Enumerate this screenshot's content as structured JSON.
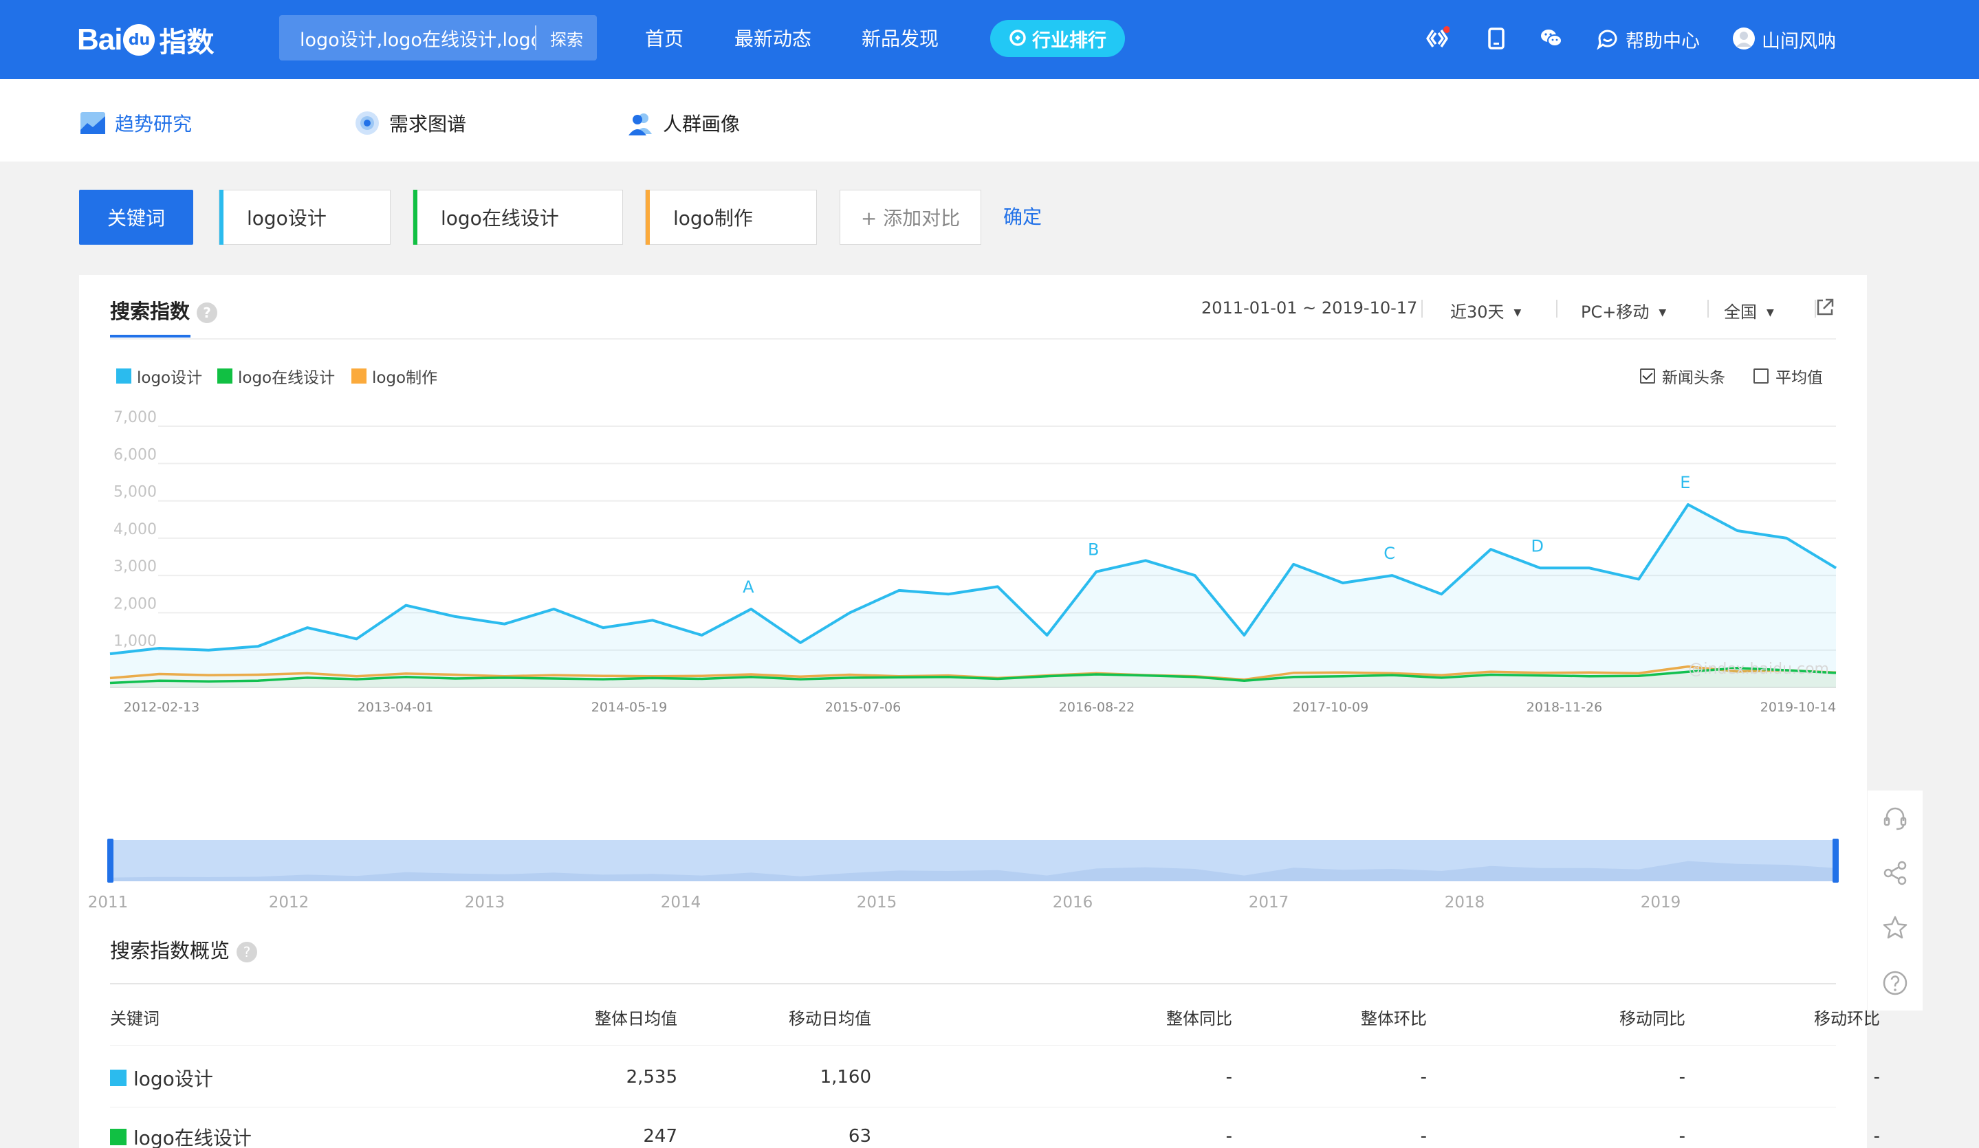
{
  "header": {
    "logo_text_left": "Bai",
    "logo_text_paw": "du",
    "logo_text_right": "指数",
    "search_value": "logo设计,logo在线设计,logo制作",
    "search_button": "探索",
    "nav": [
      "首页",
      "最新动态",
      "新品发现"
    ],
    "rank_label": "行业排行",
    "help_label": "帮助中心",
    "user_name": "山间风呐"
  },
  "subnav": {
    "tabs": [
      {
        "label": "趋势研究",
        "active": true,
        "icon": "trend-icon"
      },
      {
        "label": "需求图谱",
        "active": false,
        "icon": "demand-graph-icon"
      },
      {
        "label": "人群画像",
        "active": false,
        "icon": "crowd-portrait-icon"
      }
    ]
  },
  "keywords": {
    "label": "关键词",
    "items": [
      {
        "label": "logo设计",
        "color": "#2bbbee"
      },
      {
        "label": "logo在线设计",
        "color": "#11c043"
      },
      {
        "label": "logo制作",
        "color": "#fbaa3c"
      }
    ],
    "add_label": "+ 添加对比",
    "confirm_label": "确定"
  },
  "card": {
    "title": "搜索指数",
    "date_range": "2011-01-01 ~ 2019-10-17",
    "period": "近30天",
    "device": "PC+移动",
    "region": "全国",
    "checkboxes": [
      {
        "label": "新闻头条",
        "checked": true
      },
      {
        "label": "平均值",
        "checked": false
      }
    ]
  },
  "chart_data": {
    "type": "line",
    "ylim": [
      0,
      7000
    ],
    "y_ticks": [
      "1,000",
      "2,000",
      "3,000",
      "4,000",
      "5,000",
      "6,000",
      "7,000"
    ],
    "x_ticks": [
      "2012-02-13",
      "2013-04-01",
      "2014-05-19",
      "2015-07-06",
      "2016-08-22",
      "2017-10-09",
      "2018-11-26",
      "2019-10-14"
    ],
    "annotations": [
      "A",
      "B",
      "C",
      "D",
      "E"
    ],
    "watermark": "@index.baidu.com",
    "x": [
      "2011-01",
      "2011-04",
      "2011-07",
      "2011-10",
      "2012-01",
      "2012-04",
      "2012-07",
      "2012-10",
      "2013-01",
      "2013-04",
      "2013-07",
      "2013-10",
      "2014-01",
      "2014-04",
      "2014-07",
      "2014-10",
      "2015-01",
      "2015-04",
      "2015-07",
      "2015-10",
      "2016-01",
      "2016-04",
      "2016-07",
      "2016-10",
      "2017-01",
      "2017-04",
      "2017-07",
      "2017-10",
      "2018-01",
      "2018-04",
      "2018-07",
      "2018-10",
      "2019-01",
      "2019-04",
      "2019-07",
      "2019-10"
    ],
    "series": [
      {
        "name": "logo设计",
        "color": "#2bbbee",
        "values": [
          900,
          1050,
          1000,
          1100,
          1600,
          1300,
          2200,
          1900,
          1700,
          2100,
          1600,
          1800,
          1400,
          2100,
          1200,
          2000,
          2600,
          2500,
          2700,
          1400,
          3100,
          3400,
          3000,
          1400,
          3300,
          2800,
          3000,
          2500,
          3700,
          3200,
          3200,
          2900,
          4900,
          4200,
          4000,
          3200
        ]
      },
      {
        "name": "logo在线设计",
        "color": "#11c043",
        "values": [
          120,
          180,
          160,
          180,
          260,
          220,
          280,
          240,
          260,
          240,
          220,
          250,
          230,
          280,
          220,
          260,
          270,
          280,
          230,
          300,
          350,
          320,
          280,
          180,
          280,
          300,
          330,
          260,
          340,
          320,
          300,
          310,
          420,
          520,
          460,
          390
        ]
      },
      {
        "name": "logo制作",
        "color": "#fbaa3c",
        "values": [
          250,
          360,
          330,
          340,
          380,
          300,
          370,
          340,
          300,
          330,
          310,
          300,
          310,
          350,
          290,
          340,
          300,
          320,
          250,
          320,
          380,
          330,
          300,
          210,
          390,
          400,
          380,
          330,
          420,
          390,
          400,
          380,
          560,
          430,
          460,
          400
        ]
      }
    ]
  },
  "zoom_axis": [
    "2011",
    "2012",
    "2013",
    "2014",
    "2015",
    "2016",
    "2017",
    "2018",
    "2019"
  ],
  "overview": {
    "title": "搜索指数概览",
    "headers": [
      "关键词",
      "整体日均值",
      "移动日均值",
      "整体同比",
      "整体环比",
      "移动同比",
      "移动环比"
    ],
    "rows": [
      {
        "keyword": "logo设计",
        "color": "#2bbbee",
        "overall": "2,535",
        "mobile": "1,160",
        "yoy": "-",
        "mom": "-",
        "m_yoy": "-",
        "m_mom": "-"
      },
      {
        "keyword": "logo在线设计",
        "color": "#11c043",
        "overall": "247",
        "mobile": "63",
        "yoy": "-",
        "mom": "-",
        "m_yoy": "-",
        "m_mom": "-"
      }
    ]
  }
}
